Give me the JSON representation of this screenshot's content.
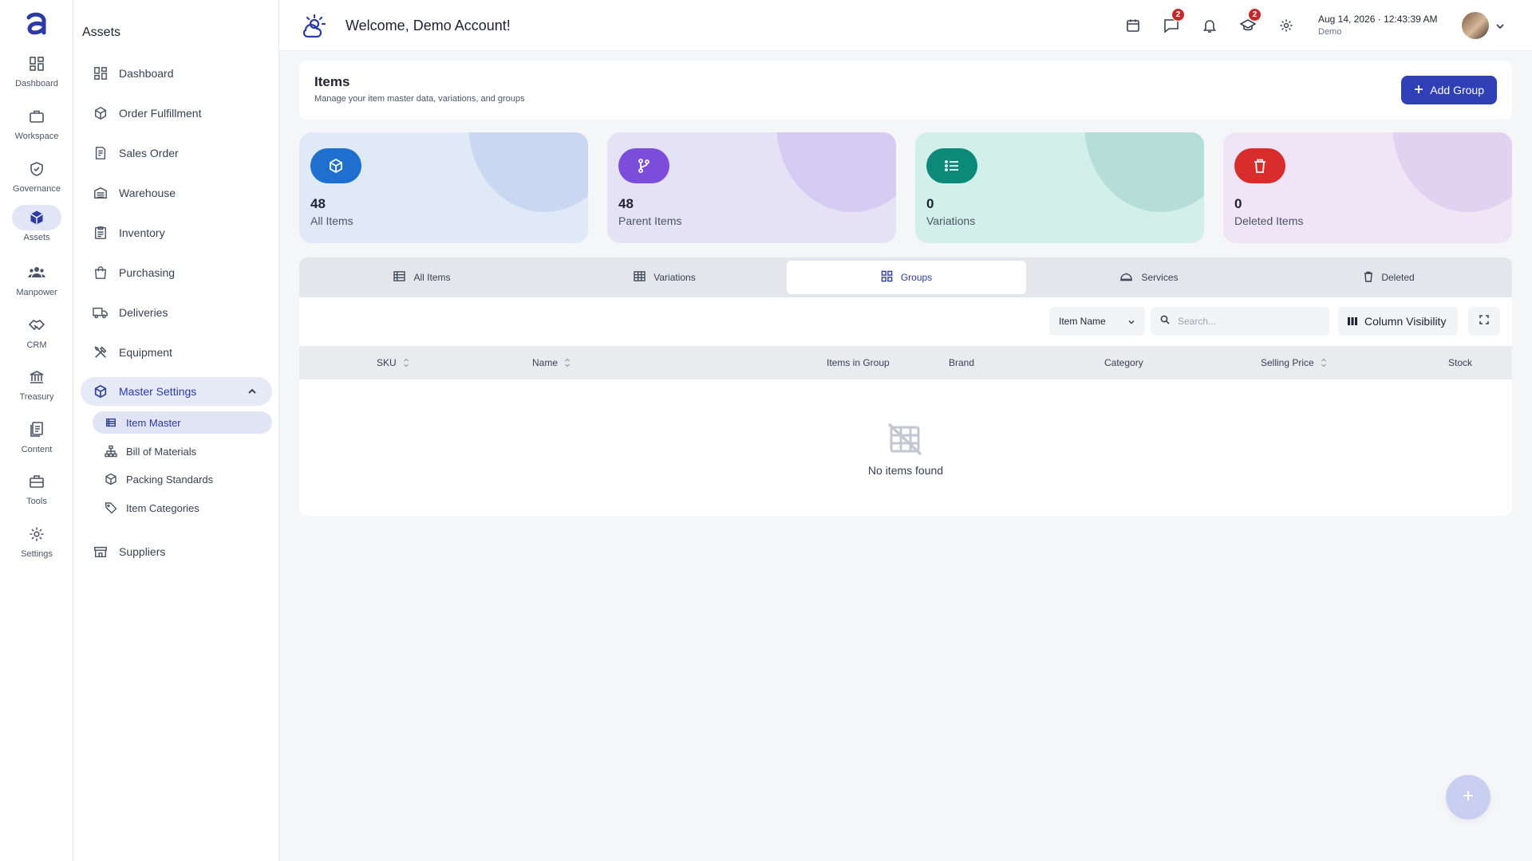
{
  "rail": {
    "items": [
      {
        "label": "Dashboard",
        "icon": "dashboard-grid-icon"
      },
      {
        "label": "Workspace",
        "icon": "briefcase-icon"
      },
      {
        "label": "Governance",
        "icon": "shield-check-icon"
      },
      {
        "label": "Assets",
        "icon": "cube-icon",
        "active": true
      },
      {
        "label": "Manpower",
        "icon": "people-icon"
      },
      {
        "label": "CRM",
        "icon": "handshake-icon"
      },
      {
        "label": "Treasury",
        "icon": "bank-icon"
      },
      {
        "label": "Content",
        "icon": "documents-icon"
      },
      {
        "label": "Tools",
        "icon": "toolbox-icon"
      },
      {
        "label": "Settings",
        "icon": "gear-icon"
      }
    ]
  },
  "sidebar": {
    "title": "Assets",
    "items": [
      {
        "label": "Dashboard",
        "icon": "dashboard-grid-icon"
      },
      {
        "label": "Order Fulfillment",
        "icon": "box-icon"
      },
      {
        "label": "Sales Order",
        "icon": "receipt-icon"
      },
      {
        "label": "Warehouse",
        "icon": "warehouse-icon"
      },
      {
        "label": "Inventory",
        "icon": "clipboard-icon"
      },
      {
        "label": "Purchasing",
        "icon": "shopping-bag-icon"
      },
      {
        "label": "Deliveries",
        "icon": "truck-icon"
      },
      {
        "label": "Equipment",
        "icon": "tools-icon"
      }
    ],
    "master_settings": {
      "label": "Master Settings",
      "icon": "cube-icon",
      "expanded": true
    },
    "sub_items": [
      {
        "label": "Item Master",
        "icon": "list-table-icon",
        "active": true
      },
      {
        "label": "Bill of Materials",
        "icon": "hierarchy-icon"
      },
      {
        "label": "Packing Standards",
        "icon": "package-icon"
      },
      {
        "label": "Item Categories",
        "icon": "tags-icon"
      }
    ],
    "suppliers": {
      "label": "Suppliers",
      "icon": "store-icon"
    }
  },
  "topbar": {
    "welcome": "Welcome, Demo Account!",
    "messages_badge": "2",
    "courses_badge": "2",
    "date": "Aug 14, 2026",
    "time": "12:43:39 AM",
    "user": "Demo"
  },
  "page": {
    "title": "Items",
    "subtitle": "Manage your item master data, variations, and groups",
    "add_button": "Add Group"
  },
  "stats": [
    {
      "value": "48",
      "label": "All Items",
      "icon": "cube-icon",
      "bg": "#e0eaf7",
      "blob": "#cad7f0",
      "icon_bg": "#1f6fd1"
    },
    {
      "value": "48",
      "label": "Parent Items",
      "icon": "branch-icon",
      "bg": "#e6e2f6",
      "blob": "#d6ccf3",
      "icon_bg": "#7c4ddb"
    },
    {
      "value": "0",
      "label": "Variations",
      "icon": "list-icon",
      "bg": "#d3efea",
      "blob": "#b5ded8",
      "icon_bg": "#0b8a79"
    },
    {
      "value": "0",
      "label": "Deleted Items",
      "icon": "trash-icon",
      "bg": "#f0e4f7",
      "blob": "#e3d1f1",
      "icon_bg": "#d92d2d"
    }
  ],
  "tabs": [
    {
      "label": "All Items",
      "icon": "list-table-icon"
    },
    {
      "label": "Variations",
      "icon": "grid-table-icon"
    },
    {
      "label": "Groups",
      "icon": "groups-grid-icon",
      "active": true
    },
    {
      "label": "Services",
      "icon": "service-bell-icon"
    },
    {
      "label": "Deleted",
      "icon": "trash-icon"
    }
  ],
  "table": {
    "filter_value": "Item Name",
    "search_placeholder": "Search...",
    "column_visibility": "Column Visibility",
    "columns": [
      "SKU",
      "Name",
      "Items in Group",
      "Brand",
      "Category",
      "Selling Price",
      "Stock"
    ],
    "empty_text": "No items found"
  },
  "colors": {
    "accent": "#2f3fb5",
    "badge": "#c62828"
  }
}
